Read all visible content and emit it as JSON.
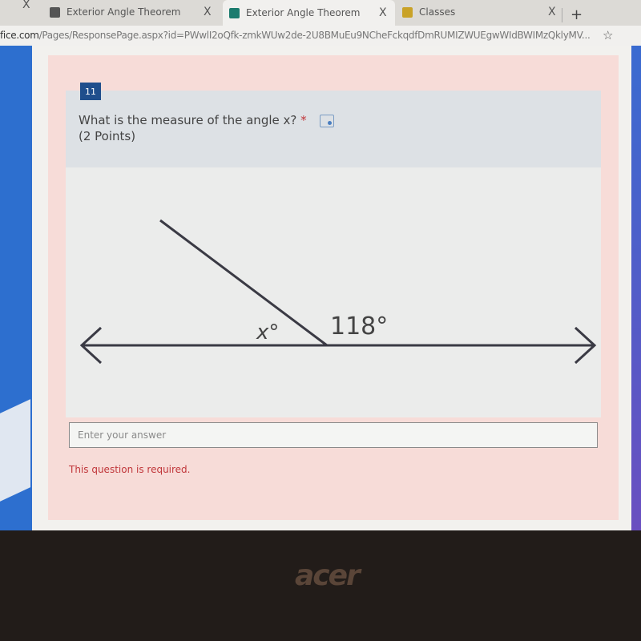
{
  "browser": {
    "tabs": [
      {
        "label": "Exterior Angle Theorem",
        "favicon": "classroom-icon",
        "active": false
      },
      {
        "label": "Exterior Angle Theorem",
        "favicon": "forms-icon",
        "active": true
      },
      {
        "label": "Classes",
        "favicon": "classroom-icon",
        "active": false
      }
    ],
    "close_glyph": "X",
    "new_tab_glyph": "+",
    "url_host": "fice.com",
    "url_path": "/Pages/ResponsePage.aspx?id=PWwlI2oQfk-zmkWUw2de-2U8BMuEu9NCheFckqdfDmRUMIZWUEgwWIdBWIMzQklyMV...",
    "bookmark_glyph": "☆"
  },
  "question": {
    "number": "11",
    "text": "What is the measure of the angle x?",
    "required_mark": "*",
    "points": "(2 Points)",
    "answer_placeholder": "Enter your answer",
    "answer_value": "",
    "error": "This question is required."
  },
  "figure": {
    "unknown_label": "x°",
    "known_label": "118°"
  },
  "device": {
    "brand": "acer"
  },
  "colors": {
    "accent": "#1f4e8c",
    "error": "#c0363a",
    "card": "#f7dcd8"
  }
}
